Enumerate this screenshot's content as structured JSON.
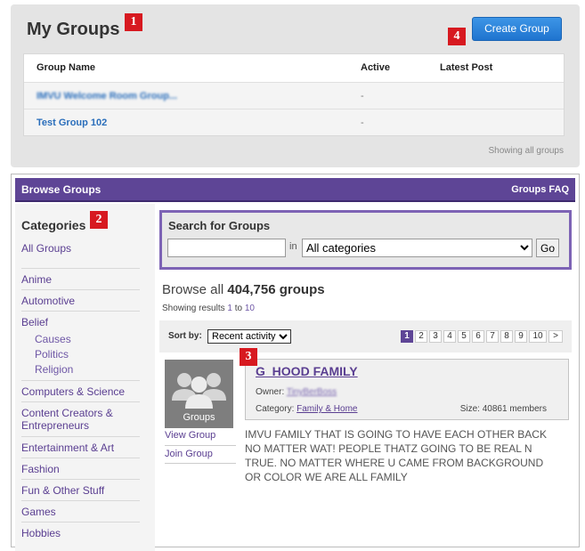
{
  "my_groups": {
    "title": "My Groups",
    "create_button": "Create Group",
    "columns": [
      "Group Name",
      "Active",
      "Latest Post"
    ],
    "rows": [
      {
        "name": "IMVU Welcome Room Group...",
        "active": "-",
        "latest": ""
      },
      {
        "name": "Test Group 102",
        "active": "-",
        "latest": ""
      }
    ],
    "showing": "Showing all groups"
  },
  "markers": {
    "m1": "1",
    "m2": "2",
    "m3": "3",
    "m4": "4"
  },
  "browse": {
    "title": "Browse Groups",
    "faq": "Groups FAQ"
  },
  "sidebar": {
    "title": "Categories",
    "items": [
      {
        "label": "All Groups"
      },
      {
        "label": "Anime"
      },
      {
        "label": "Automotive"
      },
      {
        "label": "Belief"
      },
      {
        "label": "Causes"
      },
      {
        "label": "Politics"
      },
      {
        "label": "Religion"
      },
      {
        "label": "Computers & Science"
      },
      {
        "label": "Content Creators & Entrepreneurs"
      },
      {
        "label": "Entertainment & Art"
      },
      {
        "label": "Fashion"
      },
      {
        "label": "Fun & Other Stuff"
      },
      {
        "label": "Games"
      },
      {
        "label": "Hobbies"
      }
    ]
  },
  "search": {
    "title": "Search for Groups",
    "query_value": "",
    "in_label": "in",
    "category_selected": "All categories",
    "go_label": "Go"
  },
  "results": {
    "browse_all_prefix": "Browse all ",
    "count": "404,756 groups",
    "showing_prefix": "Showing results ",
    "from": "1",
    "to_word": " to ",
    "to": "10"
  },
  "sort": {
    "label": "Sort by:",
    "selected": "Recent activity"
  },
  "pagination": {
    "pages": [
      "1",
      "2",
      "3",
      "4",
      "5",
      "6",
      "7",
      "8",
      "9",
      "10",
      ">"
    ],
    "current": "1"
  },
  "group": {
    "name": "G_HOOD FAMILY",
    "avatar_label": "Groups",
    "view_label": "View Group",
    "join_label": "Join Group",
    "owner_label": "Owner: ",
    "owner_name": "TinyBerBoss",
    "category_label": "Category: ",
    "category_value": "Family & Home",
    "size": "Size: 40861 members",
    "description": "IMVU FAMILY THAT IS GOING TO HAVE EACH OTHER BACK NO MATTER WAT! PEOPLE THATZ GOING TO BE REAL N TRUE. NO MATTER WHERE U CAME FROM BACKGROUND OR COLOR WE ARE ALL FAMILY"
  }
}
